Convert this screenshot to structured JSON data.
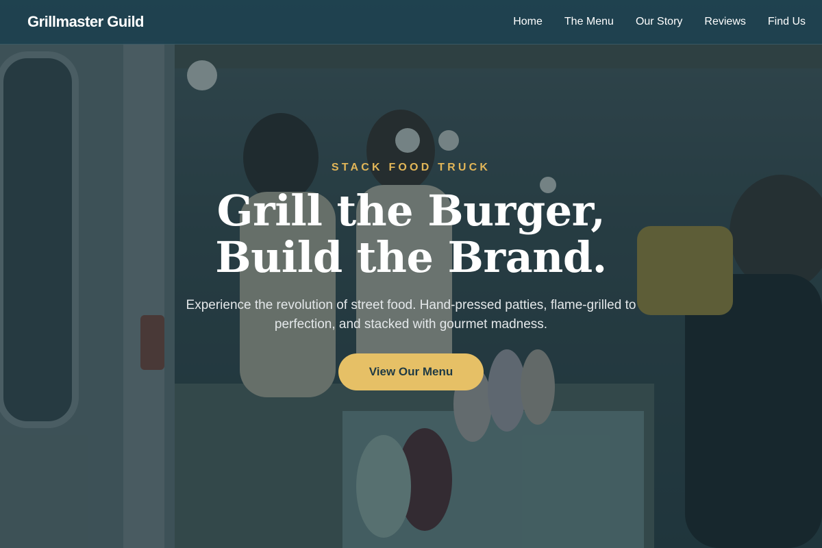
{
  "brand": {
    "name": "Grillmaster Guild"
  },
  "nav": {
    "items": [
      {
        "label": "Home"
      },
      {
        "label": "The Menu"
      },
      {
        "label": "Our Story"
      },
      {
        "label": "Reviews"
      },
      {
        "label": "Find Us"
      }
    ]
  },
  "hero": {
    "eyebrow": "STACK FOOD TRUCK",
    "headline_line1": "Grill the Burger,",
    "headline_line2": "Build the Brand.",
    "subtitle": "Experience the revolution of street food. Hand-pressed patties, flame-grilled to perfection, and stacked with gourmet madness.",
    "cta_label": "View Our Menu"
  },
  "colors": {
    "header_bg": "#1e424f",
    "accent": "#e6c066",
    "eyebrow": "#e2b658",
    "text": "#ffffff"
  }
}
